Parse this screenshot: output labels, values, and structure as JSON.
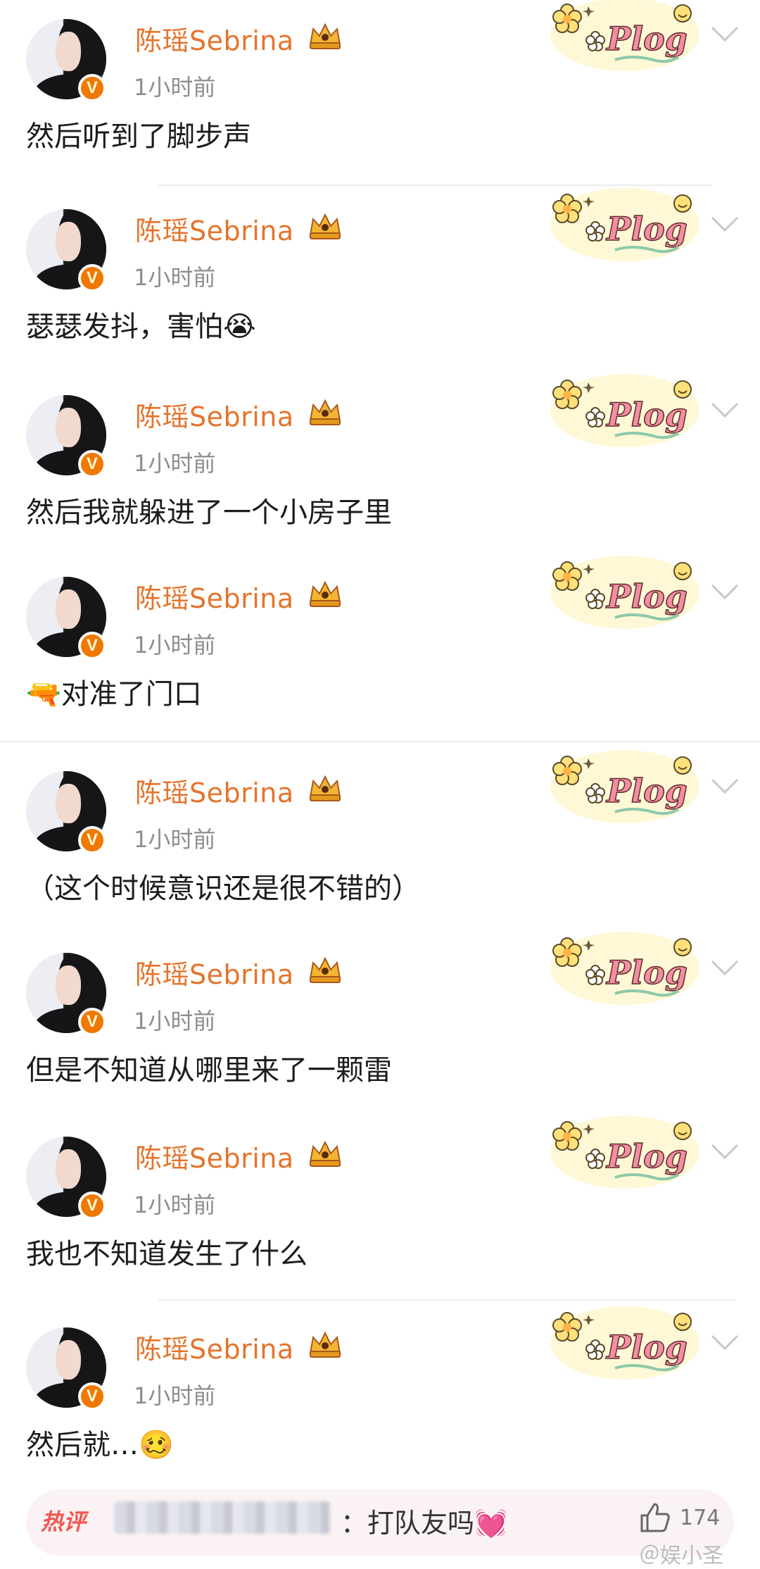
{
  "posts": [
    {
      "name": "陈瑶Sebrina",
      "time": "1小时前",
      "text": "然后听到了脚步声"
    },
    {
      "name": "陈瑶Sebrina",
      "time": "1小时前",
      "text": "瑟瑟发抖，害怕😭"
    },
    {
      "name": "陈瑶Sebrina",
      "time": "1小时前",
      "text": "然后我就躲进了一个小房子里"
    },
    {
      "name": "陈瑶Sebrina",
      "time": "1小时前",
      "text": "🔫对准了门口"
    },
    {
      "name": "陈瑶Sebrina",
      "time": "1小时前",
      "text": "（这个时候意识还是很不错的）"
    },
    {
      "name": "陈瑶Sebrina",
      "time": "1小时前",
      "text": "但是不知道从哪里来了一颗雷"
    },
    {
      "name": "陈瑶Sebrina",
      "time": "1小时前",
      "text": "我也不知道发生了什么"
    },
    {
      "name": "陈瑶Sebrina",
      "time": "1小时前",
      "text": "然后就…🥴"
    }
  ],
  "verified_badge": "V",
  "sticker_text": "Plog",
  "hot_comment": {
    "label": "热评",
    "text": "：打队友吗💓",
    "likes": "174"
  },
  "watermark": "＠娱小圣",
  "icons": {
    "verified": "verified-v-badge-icon",
    "crown": "crown-icon",
    "sticker": "plog-sticker-icon",
    "chevron": "chevron-down-icon",
    "like": "thumbs-up-icon"
  },
  "colors": {
    "name": "#e4742b",
    "badge": "#f07800",
    "hot": "#f3564f",
    "time": "#8d8d8d"
  }
}
